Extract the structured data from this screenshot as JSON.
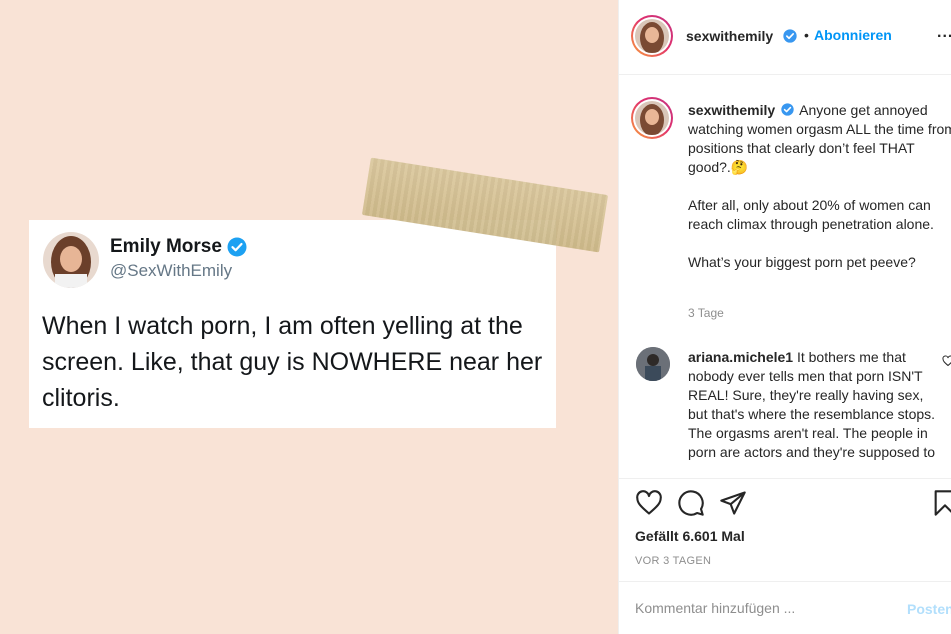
{
  "tweet": {
    "name": "Emily Morse",
    "handle": "@SexWithEmily",
    "text": "When I watch porn, I am often yelling at the screen. Like, that guy is NOWHERE near her clitoris."
  },
  "header": {
    "username": "sexwithemily",
    "separator": "•",
    "follow_label": "Abonnieren",
    "more_label": "..."
  },
  "caption": {
    "username": "sexwithemily",
    "paragraphs": [
      "Anyone get annoyed watching women orgasm ALL the time from positions that clearly don’t feel THAT good?.🤔",
      "After all, only about 20% of women can reach climax through penetration alone.",
      "What’s your biggest porn pet peeve?"
    ],
    "time": "3 Tage"
  },
  "comment": {
    "username": "ariana.michele1",
    "text": "It bothers me that nobody ever tells men that porn ISN'T REAL! Sure, they're really having sex, but that's where the resemblance stops. The orgasms aren't real. The people in porn are actors and they're supposed to"
  },
  "actions": {
    "likes": "Gefällt 6.601 Mal",
    "date": "VOR 3 TAGEN"
  },
  "composer": {
    "placeholder": "Kommentar hinzufügen ...",
    "post_label": "Posten"
  },
  "colors": {
    "background_peach": "#f9e3d6",
    "verified_blue": "#3897f0",
    "link_blue": "#0095f6",
    "muted_text": "#8e8e8e"
  },
  "icons": [
    "verified-badge-icon",
    "heart-icon",
    "comment-icon",
    "share-icon",
    "bookmark-icon",
    "more-icon"
  ]
}
